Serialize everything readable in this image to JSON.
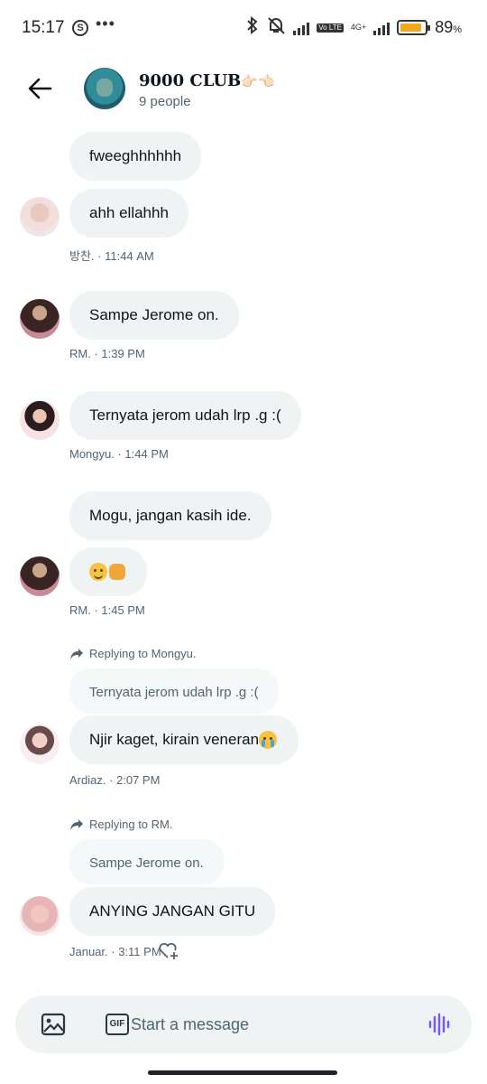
{
  "status_bar": {
    "time": "15:17",
    "app_icon_letter": "S",
    "dots": "•••",
    "battery_percent": 89,
    "battery_text": "89",
    "battery_unit": "%",
    "volte_label": "Vo LTE",
    "network_label": "4G+",
    "battery_color": "#f2a91b",
    "icons": [
      "bluetooth-icon",
      "alarm-off-icon",
      "signal-icon",
      "volte-icon",
      "network-4g-icon",
      "battery-icon"
    ]
  },
  "header": {
    "title": "9000 CLUB",
    "title_emoji": "👉🏻👈🏻",
    "subtitle": "9 people",
    "back_icon": "arrow-left-icon"
  },
  "messages": [
    {
      "text": "fweeghhhhhh"
    },
    {
      "text": "ahh ellahhh",
      "meta": "방찬. · 11:44 AM"
    },
    {
      "text": "Sampe Jerome on.",
      "meta": "RM. · 1:39 PM"
    },
    {
      "text": "Ternyata jerom udah lrp .g :(",
      "meta": "Mongyu. · 1:44 PM"
    },
    {
      "text": "Mogu, jangan kasih ide."
    },
    {
      "text": "",
      "emoji": "smile-emoji, fist-emoji",
      "meta": "RM. · 1:45 PM"
    },
    {
      "replying_to": "Replying to Mongyu.",
      "quote": "Ternyata jerom udah lrp .g :(",
      "text": "Njir kaget, kirain veneran",
      "emoji": "sob-emoji",
      "meta": "Ardiaz. · 2:07 PM"
    },
    {
      "replying_to": "Replying to RM.",
      "quote": "Sampe Jerome on.",
      "text": "ANYING JANGAN GITU",
      "meta": "Januar. · 3:11 PM"
    }
  ],
  "composer": {
    "placeholder": "Start a message",
    "gif_label": "GIF",
    "icons": [
      "image-icon",
      "gif-icon",
      "voice-message-icon"
    ],
    "accent": "#7856ff"
  },
  "colors": {
    "bubble": "#eff3f4",
    "meta_text": "#536471"
  }
}
